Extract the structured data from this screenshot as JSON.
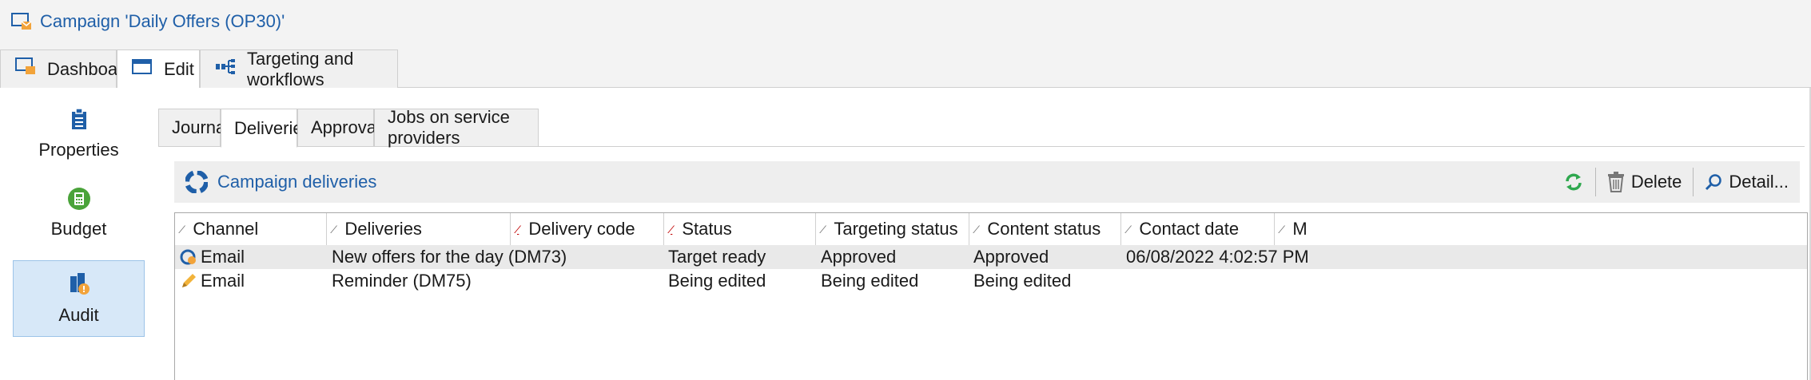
{
  "window": {
    "title": "Campaign 'Daily Offers (OP30)'"
  },
  "main_tabs": [
    {
      "label": "Dashboard",
      "icon": "dashboard-icon"
    },
    {
      "label": "Edit",
      "icon": "edit-form-icon",
      "active": true
    },
    {
      "label": "Targeting and workflows",
      "icon": "workflow-icon"
    }
  ],
  "left_nav": [
    {
      "label": "Properties",
      "icon": "clipboard-icon"
    },
    {
      "label": "Budget",
      "icon": "calculator-icon"
    },
    {
      "label": "Audit",
      "icon": "audit-icon",
      "active": true
    }
  ],
  "sub_tabs": [
    {
      "label": "Journal"
    },
    {
      "label": "Deliveries",
      "active": true
    },
    {
      "label": "Approvals"
    },
    {
      "label": "Jobs on service providers"
    }
  ],
  "panel": {
    "title": "Campaign deliveries",
    "actions": {
      "refresh": "refresh-icon",
      "delete": "Delete",
      "detail": "Detail..."
    }
  },
  "table": {
    "columns": [
      "Channel",
      "Deliveries",
      "Delivery code",
      "Status",
      "Targeting status",
      "Content status",
      "Contact date",
      "M"
    ],
    "rows": [
      {
        "icon": "delivery-status-icon",
        "channel": "Email",
        "delivery": "New offers for the day (DM73)",
        "code": "",
        "status": "Target ready",
        "targeting": "Approved",
        "content": "Approved",
        "contact_date": "06/08/2022 4:02:57 PM"
      },
      {
        "icon": "pencil-icon",
        "channel": "Email",
        "delivery": "Reminder (DM75)",
        "code": "",
        "status": "Being edited",
        "targeting": "Being edited",
        "content": "Being edited",
        "contact_date": ""
      }
    ]
  },
  "colors": {
    "accent": "#1f5fa8",
    "selection": "#d7e8f8",
    "refresh": "#2fa84f"
  }
}
